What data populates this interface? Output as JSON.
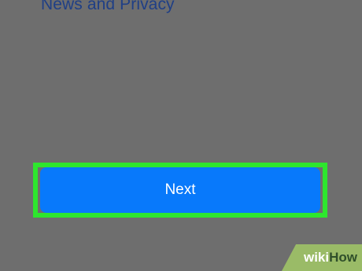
{
  "top_link": {
    "label": "News and Privacy"
  },
  "primary_action": {
    "label": "Next"
  },
  "highlight": {
    "color": "#2ee62e"
  },
  "colors": {
    "background": "#6e6e6e",
    "button": "#0879fb",
    "link": "#1f3f86"
  },
  "watermark": {
    "part1": "wiki",
    "part2": "How"
  }
}
